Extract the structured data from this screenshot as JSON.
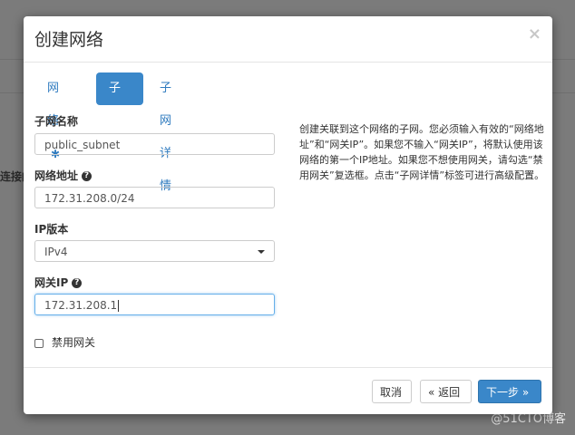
{
  "background": {
    "text_fragment": "连接的",
    "watermark": "@51CTO博客"
  },
  "modal": {
    "title": "创建网络",
    "close_icon": "×",
    "tabs": [
      {
        "label": "网络",
        "marker": "✱"
      },
      {
        "label": "子网"
      },
      {
        "label": "子网详情"
      }
    ],
    "fields": {
      "subnet_name": {
        "label": "子网名称",
        "value": "public_subnet"
      },
      "network_address": {
        "label": "网络地址",
        "value": "172.31.208.0/24",
        "help_icon": "?"
      },
      "ip_version": {
        "label": "IP版本",
        "value": "IPv4"
      },
      "gateway_ip": {
        "label": "网关IP",
        "value": "172.31.208.1",
        "help_icon": "?"
      }
    },
    "checkbox_label": "禁用网关",
    "description": "创建关联到这个网络的子网。您必须输入有效的“网络地址”和“网关IP”。如果您不输入“网关IP”，将默认使用该网络的第一个IP地址。如果您不想使用网关，请勾选“禁用网关”复选框。点击“子网详情”标签可进行高级配置。",
    "buttons": {
      "cancel": "取消",
      "back": "« 返回",
      "next": "下一步 »"
    }
  },
  "colors": {
    "primary": "#3a87c9",
    "backdrop": "#7b7b7b"
  }
}
